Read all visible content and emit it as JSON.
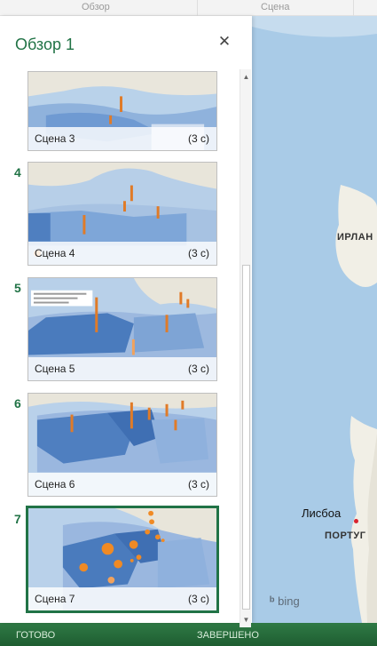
{
  "top_tabs": [
    "Обзор",
    "Сцена"
  ],
  "panel": {
    "title": "Обзор 1",
    "close_glyph": "✕"
  },
  "scenes": [
    {
      "number": "",
      "name": "Сцена 3",
      "duration": "(3 с)",
      "selected": false
    },
    {
      "number": "4",
      "name": "Сцена 4",
      "duration": "(3 с)",
      "selected": false
    },
    {
      "number": "5",
      "name": "Сцена 5",
      "duration": "(3 с)",
      "selected": false
    },
    {
      "number": "6",
      "name": "Сцена 6",
      "duration": "(3 с)",
      "selected": false
    },
    {
      "number": "7",
      "name": "Сцена 7",
      "duration": "(3 с)",
      "selected": true
    }
  ],
  "map": {
    "labels": [
      "ИРЛАН",
      "ПОРТУГ"
    ],
    "city": "Лисбоа",
    "logo": "bing",
    "colors": {
      "sea": "#a9cbe7",
      "land": "#f1efe6",
      "accent": "#217346"
    }
  },
  "bottom_bar": {
    "left_label": "ГОТОВО",
    "right_label": "ЗАВЕРШЕНО"
  }
}
